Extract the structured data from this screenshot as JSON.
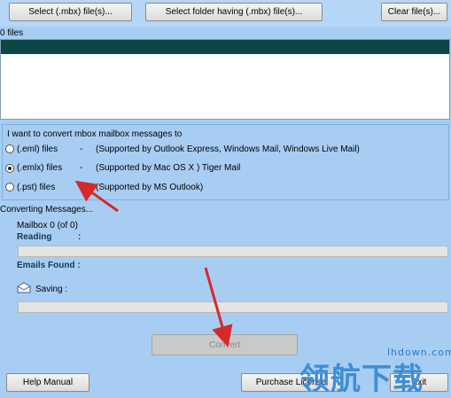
{
  "toolbar": {
    "select_files": "Select (.mbx) file(s)...",
    "select_folder": "Select folder having (.mbx) file(s)...",
    "clear_files": "Clear file(s)..."
  },
  "files": {
    "count_label": "0 files"
  },
  "convert_group": {
    "title": "I want to convert mbox mailbox messages to",
    "options": [
      {
        "label": "(.eml) files",
        "dash": "-",
        "desc": "(Supported by Outlook Express, Windows Mail, Windows Live Mail)",
        "selected": false
      },
      {
        "label": "(.emlx) files",
        "dash": "-",
        "desc": "(Supported by Mac OS X ) Tiger Mail",
        "selected": true
      },
      {
        "label": "(.pst) files",
        "dash": "-",
        "desc": "(Supported by MS Outlook)",
        "selected": false
      }
    ]
  },
  "progress": {
    "title": "Converting Messages...",
    "mailbox": "Mailbox  0 (of 0)",
    "reading_label": "Reading",
    "reading_colon": ":",
    "emails_found": "Emails Found :",
    "saving_label": "Saving :",
    "reading_progress": 0,
    "saving_progress": 0
  },
  "actions": {
    "convert": "Convert",
    "help": "Help Manual",
    "purchase": "Purchase License",
    "exit": "Exit"
  },
  "watermark": {
    "site": "lhdown.com",
    "chars": "领航下载"
  },
  "colors": {
    "background": "#a8cdf3",
    "arrow": "#d42a2a",
    "list_header": "#0d4647"
  },
  "icons": {
    "saving": "envelope-icon",
    "annotation": "red-arrow"
  }
}
